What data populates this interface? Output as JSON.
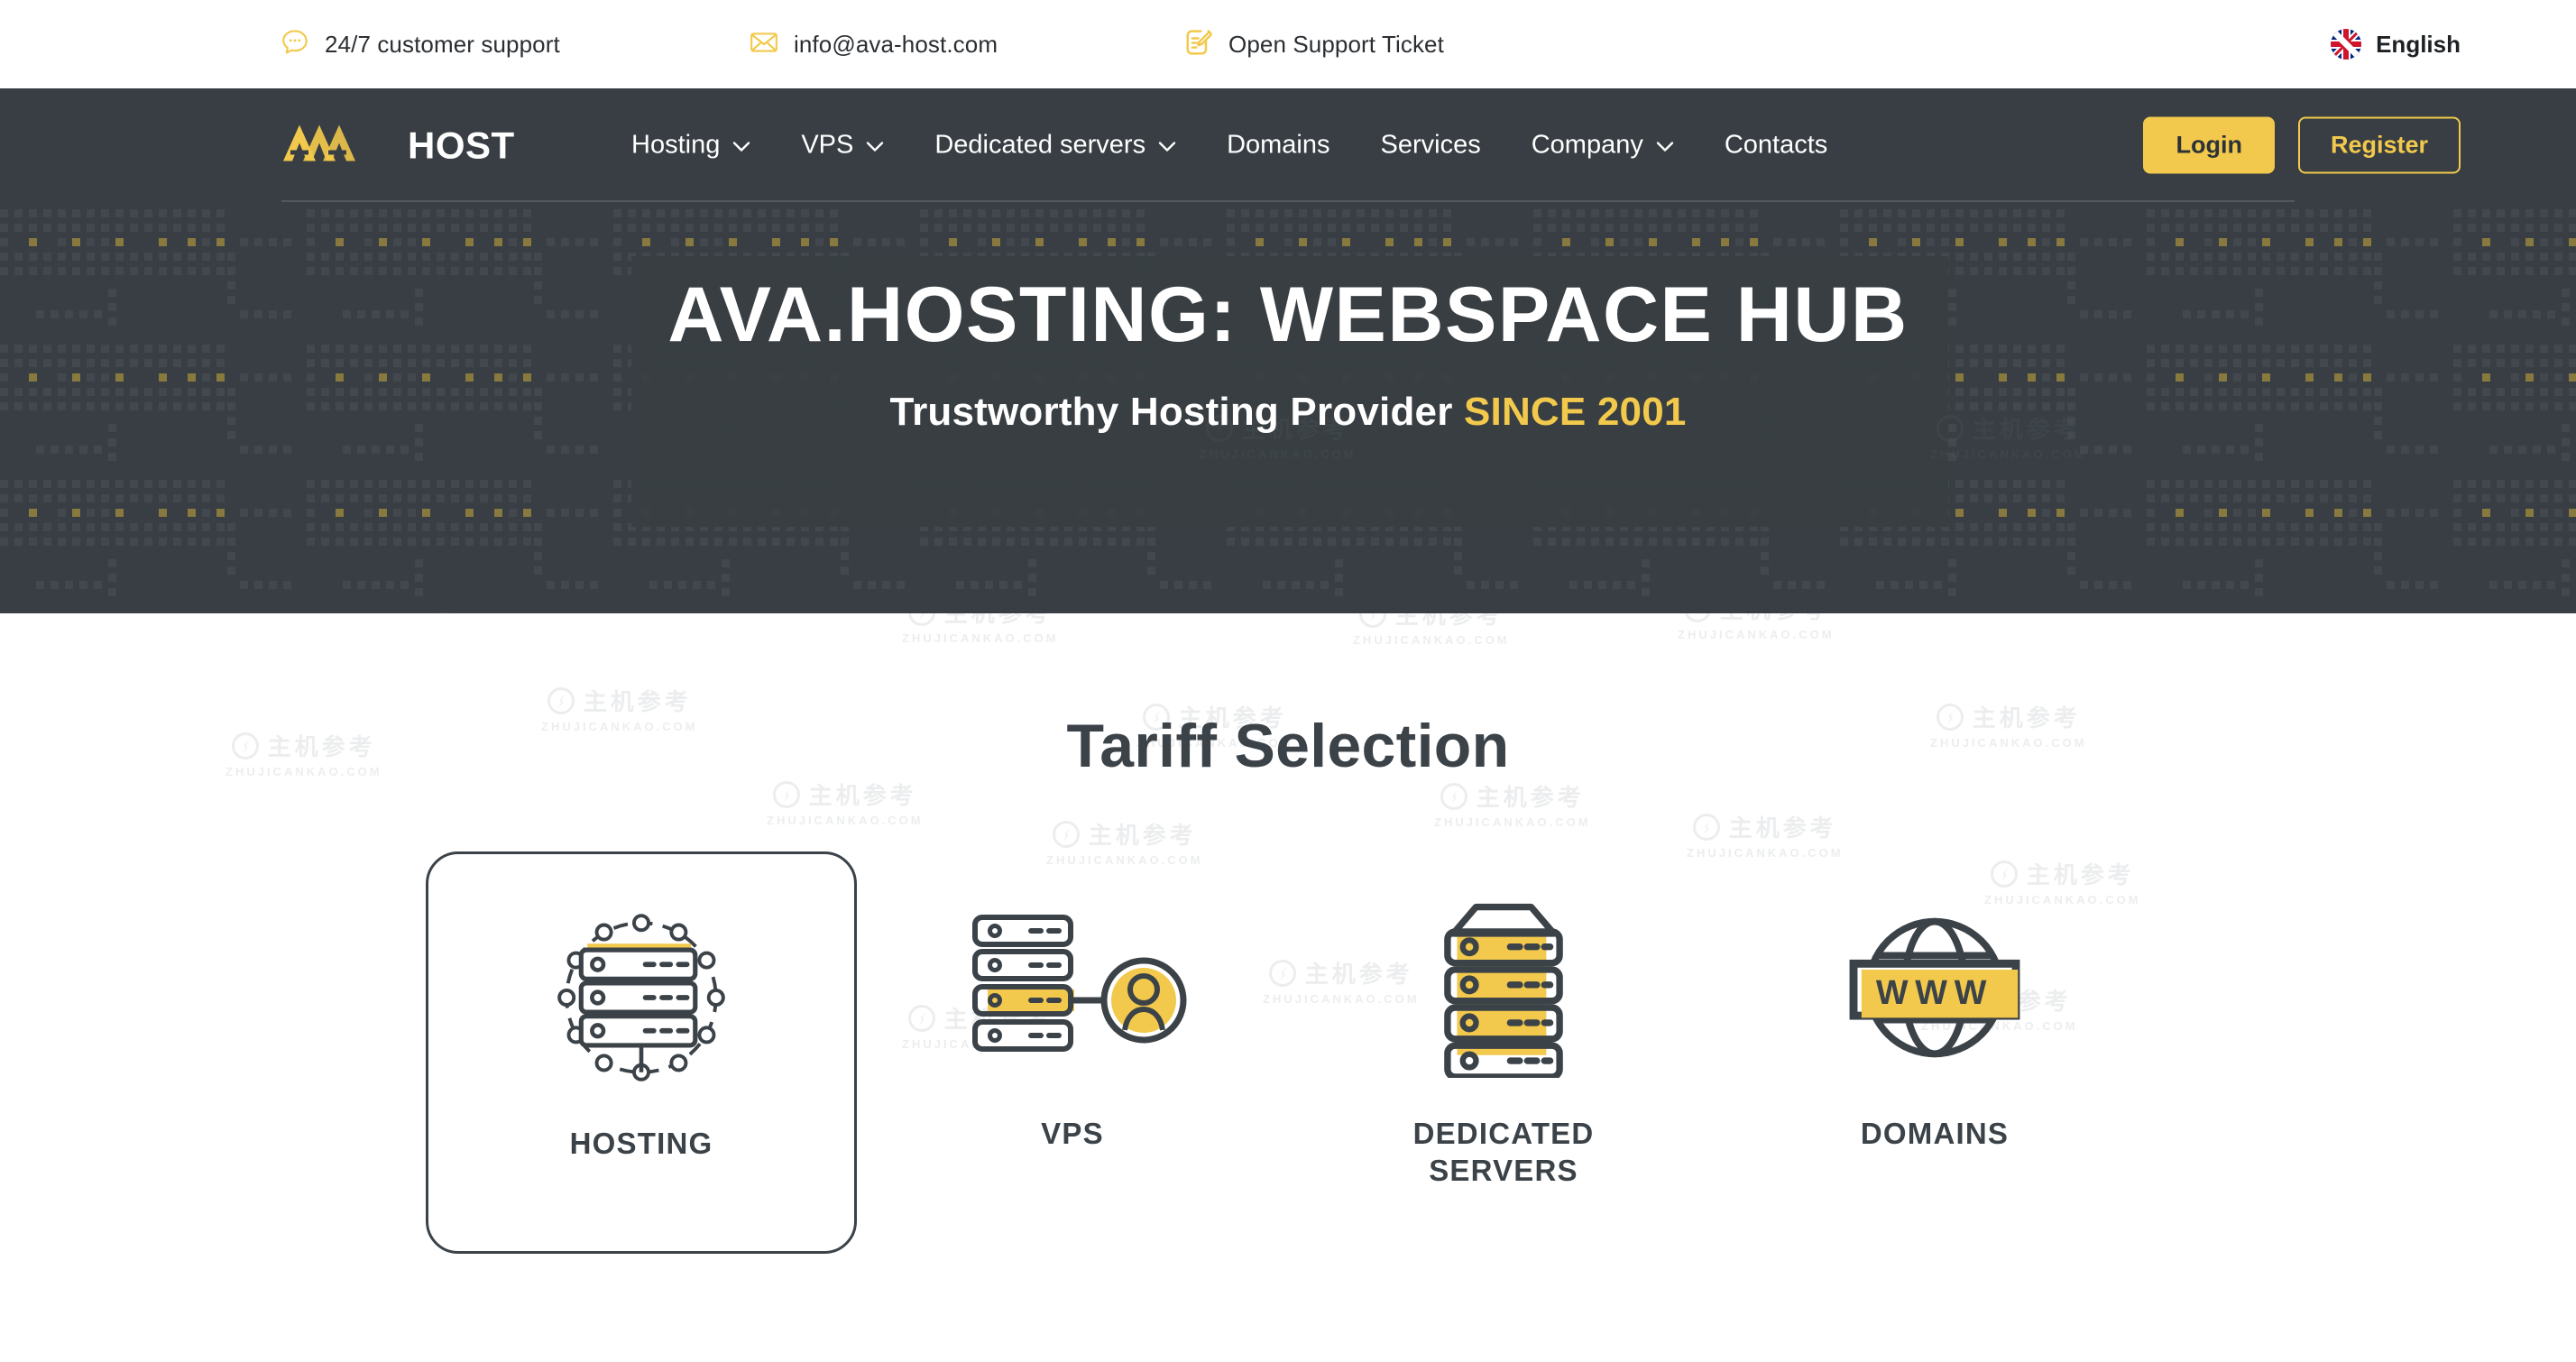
{
  "colors": {
    "dark": "#383e43",
    "accent": "#f2c94c",
    "text_dark": "#3b4248",
    "white": "#ffffff"
  },
  "topbar": {
    "items": [
      {
        "icon": "chat-bubble-icon",
        "label": "24/7 customer support"
      },
      {
        "icon": "envelope-icon",
        "label": "info@ava-host.com"
      },
      {
        "icon": "ticket-edit-icon",
        "label": "Open Support Ticket"
      }
    ],
    "language": {
      "icon": "uk-flag-icon",
      "label": "English"
    }
  },
  "header": {
    "logo": {
      "mark": "ava-logo-icon",
      "accent_text": "AVA",
      "word": "HOST"
    },
    "nav": [
      {
        "label": "Hosting",
        "has_dropdown": true
      },
      {
        "label": "VPS",
        "has_dropdown": true
      },
      {
        "label": "Dedicated servers",
        "has_dropdown": true
      },
      {
        "label": "Domains",
        "has_dropdown": false
      },
      {
        "label": "Services",
        "has_dropdown": false
      },
      {
        "label": "Company",
        "has_dropdown": true
      },
      {
        "label": "Contacts",
        "has_dropdown": false
      }
    ],
    "login_label": "Login",
    "register_label": "Register"
  },
  "hero": {
    "title": "AVA.HOSTING: WEBSPACE HUB",
    "subtitle_plain": "Trustworthy Hosting Provider ",
    "subtitle_accent": "SINCE 2001"
  },
  "tariff": {
    "title": "Tariff Selection",
    "cards": [
      {
        "label": "HOSTING",
        "icon": "server-network-icon",
        "selected": true
      },
      {
        "label": "VPS",
        "icon": "server-user-icon",
        "selected": false
      },
      {
        "label": "DEDICATED\nSERVERS",
        "icon": "server-tower-icon",
        "selected": false
      },
      {
        "label": "DOMAINS",
        "icon": "globe-www-icon",
        "selected": false
      }
    ]
  },
  "watermark": {
    "cn": "主机参考",
    "en": "ZHUJICANKAO.COM"
  }
}
